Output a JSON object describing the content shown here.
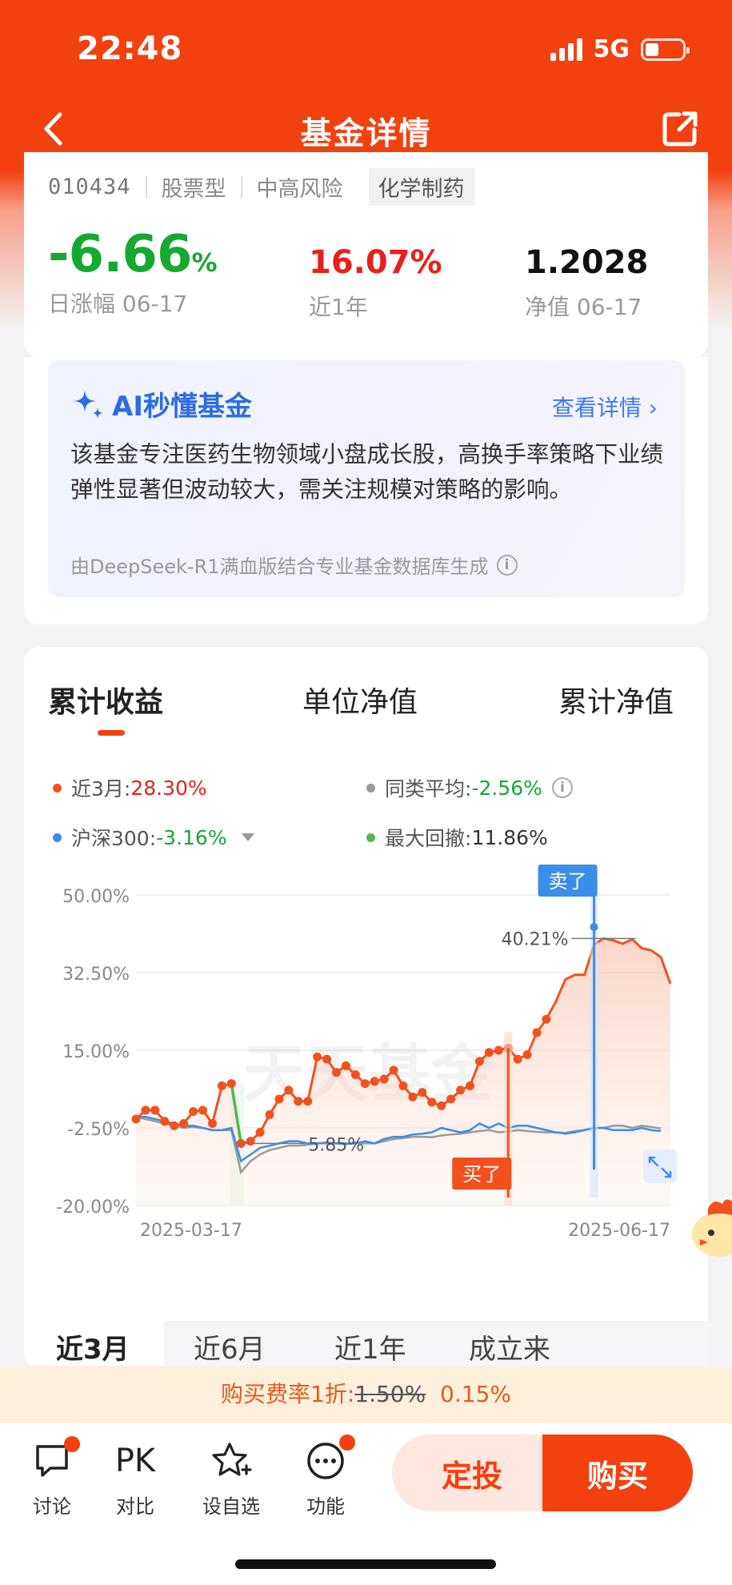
{
  "status": {
    "time": "22:48",
    "network": "5G"
  },
  "nav": {
    "title": "基金详情"
  },
  "fund": {
    "code": "010434",
    "type": "股票型",
    "risk": "中高风险",
    "sector": "化学制药",
    "day_change": "-6.66",
    "day_change_unit": "%",
    "day_change_label": "日涨幅 06-17",
    "year_return": "16.07%",
    "year_return_label": "近1年",
    "nav_value": "1.2028",
    "nav_label": "净值 06-17"
  },
  "ai": {
    "title": "AI秒懂基金",
    "more": "查看详情",
    "text": "该基金专注医药生物领域小盘成长股，高换手率策略下业绩弹性显著但波动较大，需关注规模对策略的影响。",
    "footer": "由DeepSeek-R1满血版结合专业基金数据库生成"
  },
  "chart_tabs": [
    "累计收益",
    "单位净值",
    "累计净值"
  ],
  "legend": {
    "fund_label": "近3月:",
    "fund_value": "28.30%",
    "avg_label": "同类平均:",
    "avg_value": "-2.56%",
    "hs300_label": "沪深300:",
    "hs300_value": "-3.16%",
    "drawdown_label": "最大回撤:",
    "drawdown_value": "11.86%"
  },
  "chart_data": {
    "type": "line",
    "ylim": [
      -20,
      50
    ],
    "y_ticks": [
      "50.00%",
      "32.50%",
      "15.00%",
      "-2.50%",
      "-20.00%"
    ],
    "x_ticks": [
      "2025-03-17",
      "2025-06-17"
    ],
    "watermark": "天天基金",
    "annotations": {
      "sell": "卖了",
      "buy": "买了",
      "peak": "40.21%",
      "trough": "5.85%"
    },
    "series": [
      {
        "name": "近3月",
        "color": "#f2511d",
        "values": [
          -0.5,
          1.5,
          1.5,
          -1,
          -2,
          -1.5,
          1.2,
          1.5,
          -1.5,
          7,
          7.5,
          -6,
          -5.5,
          -3.5,
          0.5,
          4,
          6,
          3.5,
          3.5,
          13.5,
          13,
          10,
          11.5,
          9.5,
          7.5,
          8,
          8.5,
          10.5,
          7,
          4.5,
          5.5,
          3.3,
          2.5,
          4,
          6,
          7,
          12.5,
          14.5,
          15,
          15.5,
          13,
          14,
          19,
          22,
          26,
          31,
          32,
          32,
          38.8,
          40.2,
          39.8,
          39,
          40,
          38,
          37.5,
          36,
          30
        ]
      },
      {
        "name": "沪深300",
        "color": "#3c8de8",
        "values": [
          0,
          0,
          -0.5,
          -1,
          -1.5,
          -2,
          -2,
          -2.5,
          -3,
          -3,
          -2.5,
          -10,
          -8.5,
          -7,
          -6.5,
          -6,
          -5.5,
          -5.5,
          -6,
          -6,
          -5.8,
          -6,
          -6,
          -6,
          -5.5,
          -6,
          -5,
          -4.5,
          -4.5,
          -4,
          -3.8,
          -3.5,
          -2.5,
          -3,
          -3.5,
          -3,
          -1.5,
          -2.5,
          -1.5,
          -2.5,
          -2,
          -2,
          -2.5,
          -3,
          -3.5,
          -3.8,
          -3.5,
          -3,
          -2.5,
          -2.5,
          -3,
          -3,
          -3,
          -2.5,
          -3,
          -3.2
        ]
      },
      {
        "name": "同类平均",
        "color": "#9a9a9a",
        "values": [
          0,
          -0.5,
          -1,
          -1.5,
          -2,
          -2.5,
          -2.3,
          -2.5,
          -3,
          -3,
          -3,
          -12.5,
          -10,
          -8.5,
          -7.5,
          -7,
          -6.5,
          -6.5,
          -6.3,
          -6,
          -6,
          -6,
          -6.2,
          -5.8,
          -6,
          -6,
          -5.5,
          -5,
          -4.8,
          -4.5,
          -4.5,
          -4.6,
          -4.2,
          -4,
          -3.8,
          -3.5,
          -3.2,
          -3,
          -3.5,
          -3.3,
          -3,
          -3.2,
          -3.4,
          -3.5,
          -3.5,
          -3.6,
          -3.2,
          -3,
          -2.5,
          -2.5,
          -2,
          -2,
          -2.5,
          -2,
          -2.3,
          -2.6
        ]
      }
    ]
  },
  "periods": [
    "近3月",
    "近6月",
    "近1年",
    "成立来"
  ],
  "fee": {
    "prefix": "购买费率1折:",
    "old": "1.50%",
    "new": "0.15%"
  },
  "bottom": {
    "discuss": "讨论",
    "compare_icon": "PK",
    "compare": "对比",
    "watch": "设自选",
    "more": "功能",
    "dingtou": "定投",
    "buy": "购买"
  }
}
